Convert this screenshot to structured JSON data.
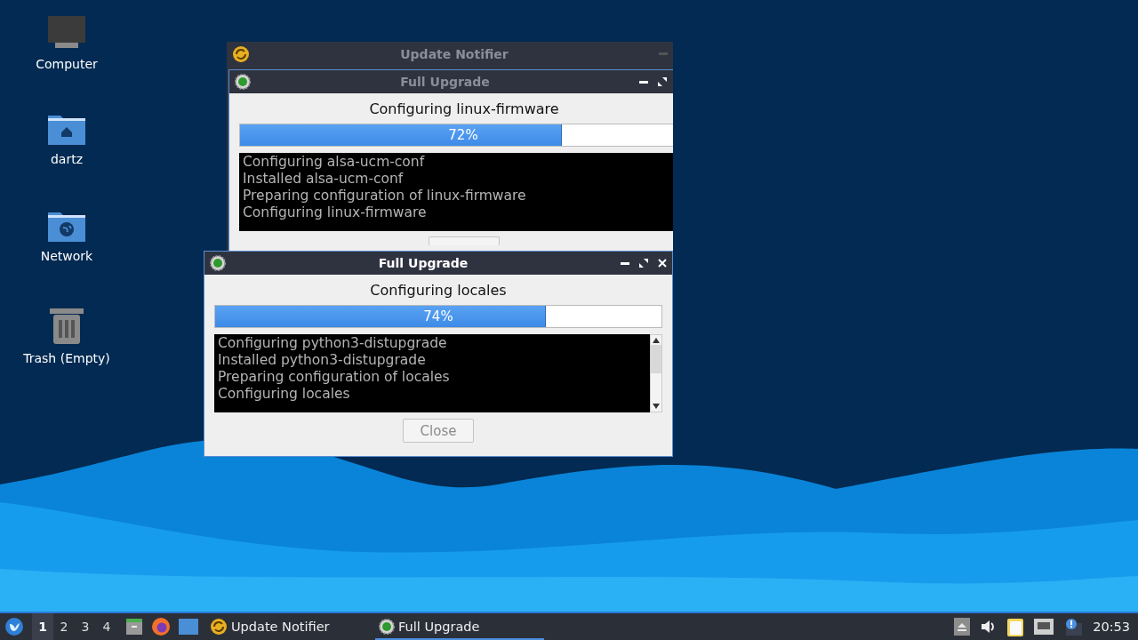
{
  "desktop_icons": [
    {
      "kind": "computer",
      "label": "Computer"
    },
    {
      "kind": "home",
      "label": "dartz"
    },
    {
      "kind": "network",
      "label": "Network"
    },
    {
      "kind": "trash",
      "label": "Trash (Empty)"
    }
  ],
  "notifier_window": {
    "title": "Update Notifier",
    "active": false,
    "upgrade_window": {
      "title": "Full Upgrade",
      "active": false,
      "status": "Configuring linux-firmware",
      "progress": {
        "level": 0.72,
        "reading": "72%"
      },
      "log": [
        "Configuring alsa-ucm-conf",
        "Installed alsa-ucm-conf",
        "Preparing configuration of linux-firmware",
        "Configuring linux-firmware"
      ]
    }
  },
  "upgrade_window": {
    "title": "Full Upgrade",
    "active": true,
    "status": "Configuring locales",
    "progress": {
      "level": 0.74,
      "reading": "74%"
    },
    "log": [
      "Configuring python3-distupgrade",
      "Installed python3-distupgrade",
      "Preparing configuration of locales",
      "Configuring locales"
    ],
    "close_button": {
      "label": "Close",
      "disabled": true
    }
  },
  "taskbar": {
    "workspaces": [
      {
        "label": "1",
        "selected": true
      },
      {
        "label": "2",
        "selected": false
      },
      {
        "label": "3",
        "selected": false
      },
      {
        "label": "4",
        "selected": false
      }
    ],
    "tasks": [
      {
        "kind": "notifier",
        "label": "Update Notifier",
        "selected": false
      },
      {
        "kind": "upgrade",
        "label": "Full Upgrade",
        "selected": true
      }
    ],
    "clock": "20:53"
  }
}
